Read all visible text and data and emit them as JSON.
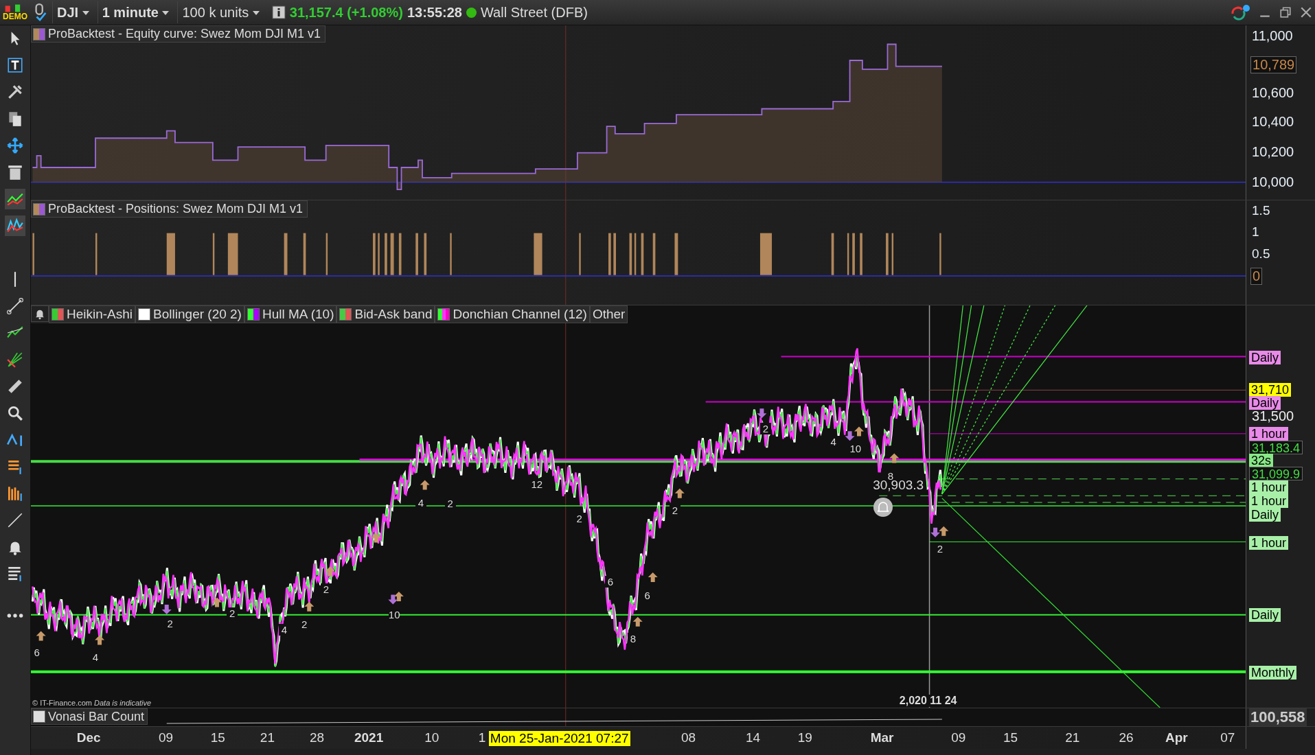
{
  "toolbar": {
    "logo": "DEMO",
    "symbol": "DJI",
    "timeframe": "1 minute",
    "units": "100 k units",
    "quote": "31,157.4 (+1.08%)",
    "time": "13:55:28",
    "market_open": true,
    "market": "Wall Street (DFB)"
  },
  "equity_panel": {
    "title": "ProBacktest - Equity curve: Swez Mom DJI M1 v1",
    "swatch": [
      {
        "color": "#b08a5c"
      },
      {
        "color": "#9b59d0"
      }
    ],
    "axis_labels": [
      "11,000",
      "10,600",
      "10,400",
      "10,200",
      "10,000"
    ],
    "current_tag": "10,789"
  },
  "positions_panel": {
    "title": "ProBacktest - Positions: Swez Mom DJI M1 v1",
    "swatch": [
      {
        "color": "#b08a5c"
      },
      {
        "color": "#9b59d0"
      }
    ],
    "axis_labels": [
      "1.5",
      "1",
      "0.5"
    ],
    "current_tag": "0"
  },
  "price_panel": {
    "legend": [
      {
        "label": "Heikin-Ashi",
        "colors": [
          {
            "color": "#33cc33"
          },
          {
            "color": "#e05555"
          }
        ]
      },
      {
        "label": "Bollinger (20 2)",
        "colors": [
          {
            "color": "#ffffff"
          }
        ]
      },
      {
        "label": "Hull MA (10)",
        "colors": [
          {
            "color": "#33ff33"
          },
          {
            "color": "#aa00ff"
          }
        ]
      },
      {
        "label": "Bid-Ask band",
        "colors": [
          {
            "color": "#44cc44"
          },
          {
            "color": "#e05555"
          }
        ]
      },
      {
        "label": "Donchian Channel (12)",
        "colors": [
          {
            "color": "#33ff33"
          },
          {
            "color": "#ff33ff"
          },
          {
            "color": "#ff00cc"
          }
        ]
      },
      {
        "label": "Other"
      }
    ],
    "annotations": [
      "6",
      "4",
      "2",
      "2",
      "4",
      "2",
      "2",
      "10",
      "4",
      "2",
      "12",
      "2",
      "6",
      "6",
      "8",
      "2",
      "2",
      "4",
      "10",
      "8",
      "2"
    ],
    "last_low_label": "30,903.3",
    "cut_label": "2,020 11 24",
    "credit": "© IT-Finance.com",
    "credit_note": "Data is indicative",
    "axis_tags": [
      {
        "text": "Daily",
        "kind": "tag",
        "color": "#e88ae8"
      },
      {
        "text": "31,710",
        "kind": "tag",
        "color": "#ffff00"
      },
      {
        "text": "Daily",
        "kind": "tag",
        "color": "#e88ae8"
      },
      {
        "text": "31,500",
        "kind": "tick"
      },
      {
        "text": "1 hour",
        "kind": "tag",
        "color": "#e88ae8"
      },
      {
        "text": "31,183.4",
        "kind": "value",
        "color": "#44dd44"
      },
      {
        "text": "32s",
        "kind": "tag",
        "color": "#88e888"
      },
      {
        "text": "31,099.9",
        "kind": "value",
        "color": "#44dd44"
      },
      {
        "text": "1 hour",
        "kind": "tag",
        "color": "#a8f0a8"
      },
      {
        "text": "1 hour",
        "kind": "tag",
        "color": "#a8f0a8"
      },
      {
        "text": "Daily",
        "kind": "tag",
        "color": "#a8f0a8"
      },
      {
        "text": "1 hour",
        "kind": "tag",
        "color": "#a8f0a8"
      },
      {
        "text": "Daily",
        "kind": "tag",
        "color": "#a8f0a8"
      },
      {
        "text": "Monthly",
        "kind": "tag",
        "color": "#a8f0a8"
      }
    ]
  },
  "vonasi_panel": {
    "title": "Vonasi Bar Count",
    "swatch": [
      {
        "color": "#dddddd"
      }
    ],
    "axis_tag": "100,558"
  },
  "time_axis": {
    "labels": [
      {
        "text": "Dec",
        "kind": "month"
      },
      {
        "text": "09",
        "kind": "day"
      },
      {
        "text": "15",
        "kind": "day"
      },
      {
        "text": "21",
        "kind": "day"
      },
      {
        "text": "28",
        "kind": "day"
      },
      {
        "text": "2021",
        "kind": "month"
      },
      {
        "text": "10",
        "kind": "day"
      },
      {
        "text": "1",
        "kind": "day"
      },
      {
        "text": "08",
        "kind": "day"
      },
      {
        "text": "14",
        "kind": "day"
      },
      {
        "text": "19",
        "kind": "day"
      },
      {
        "text": "Mar",
        "kind": "month"
      },
      {
        "text": "09",
        "kind": "day"
      },
      {
        "text": "15",
        "kind": "day"
      },
      {
        "text": "21",
        "kind": "day"
      },
      {
        "text": "26",
        "kind": "day"
      },
      {
        "text": "Apr",
        "kind": "month"
      },
      {
        "text": "07",
        "kind": "day"
      }
    ],
    "crosshair_label": "Mon 25-Jan-2021 07:27"
  }
}
